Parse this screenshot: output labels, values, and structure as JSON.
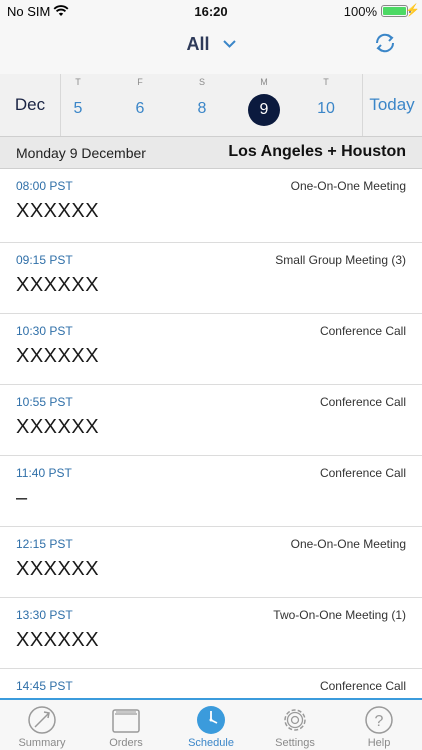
{
  "status": {
    "carrier": "No SIM",
    "time": "16:20",
    "battery": "100%"
  },
  "nav": {
    "filter_label": "All"
  },
  "week": {
    "month": "Dec",
    "days": [
      {
        "dow": "T",
        "num": "5"
      },
      {
        "dow": "F",
        "num": "6"
      },
      {
        "dow": "S",
        "num": "8"
      },
      {
        "dow": "M",
        "num": "9"
      },
      {
        "dow": "T",
        "num": "10"
      }
    ],
    "today_label": "Today"
  },
  "header": {
    "date": "Monday 9 December",
    "location": "Los Angeles + Houston"
  },
  "meetings": [
    {
      "time": "08:00 PST",
      "type": "One-On-One Meeting",
      "title": "XXXXXX"
    },
    {
      "time": "09:15 PST",
      "type": "Small Group Meeting (3)",
      "title": "XXXXXX"
    },
    {
      "time": "10:30 PST",
      "type": "Conference Call",
      "title": "XXXXXX"
    },
    {
      "time": "10:55 PST",
      "type": "Conference Call",
      "title": "XXXXXX"
    },
    {
      "time": "11:40 PST",
      "type": "Conference Call",
      "title": "–"
    },
    {
      "time": "12:15 PST",
      "type": "One-On-One Meeting",
      "title": "XXXXXX"
    },
    {
      "time": "13:30 PST",
      "type": "Two-On-One Meeting (1)",
      "title": "XXXXXX"
    },
    {
      "time": "14:45 PST",
      "type": "Conference Call",
      "title": ""
    }
  ],
  "tabs": [
    {
      "label": "Summary",
      "icon": "gauge-icon"
    },
    {
      "label": "Orders",
      "icon": "folder-icon"
    },
    {
      "label": "Schedule",
      "icon": "clock-icon"
    },
    {
      "label": "Settings",
      "icon": "gear-icon"
    },
    {
      "label": "Help",
      "icon": "help-icon"
    }
  ],
  "colors": {
    "accent": "#3b86c8",
    "selected_day": "#0b1a3e",
    "tab_indicator": "#3b9bdc",
    "battery": "#4cd964"
  }
}
